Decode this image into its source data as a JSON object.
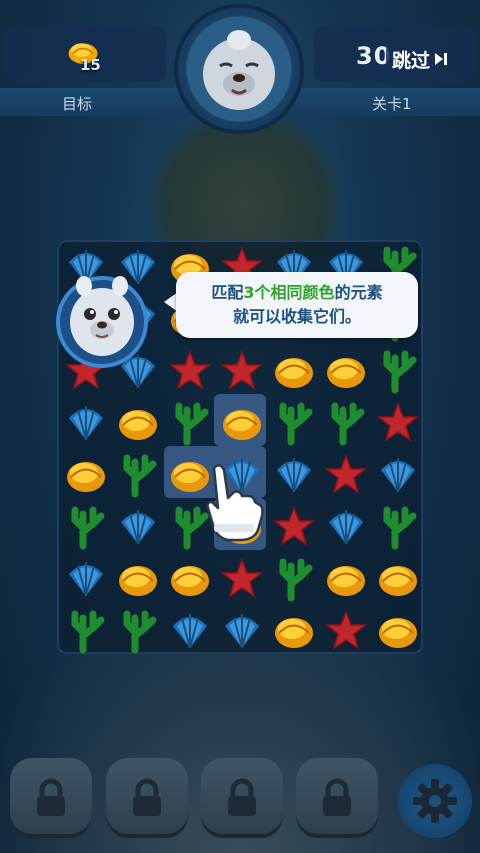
{
  "hud": {
    "goal_count": "15",
    "goal_label": "目标",
    "level_label": "关卡1",
    "moves_left": "30",
    "skip_label": "跳过"
  },
  "tutorial": {
    "line1_a": "匹配",
    "line1_b": "3个相同颜色",
    "line1_c": "的元素",
    "line2": "就可以收集它们。"
  },
  "board": {
    "grid": [
      [
        "blue-shell",
        "blue-shell",
        "yellow-snail",
        "red-star",
        "blue-shell",
        "blue-shell",
        "green-coral"
      ],
      [
        "blue-shell",
        "blue-shell",
        "yellow-snail",
        "red-star",
        "yellow-snail",
        "yellow-snail",
        "green-coral"
      ],
      [
        "red-star",
        "blue-shell",
        "red-star",
        "red-star",
        "yellow-snail",
        "yellow-snail",
        "green-coral"
      ],
      [
        "blue-shell",
        "yellow-snail",
        "green-coral",
        "yellow-snail",
        "green-coral",
        "green-coral",
        "red-star"
      ],
      [
        "yellow-snail",
        "green-coral",
        "yellow-snail",
        "blue-shell",
        "blue-shell",
        "red-star",
        "blue-shell"
      ],
      [
        "green-coral",
        "blue-shell",
        "green-coral",
        "yellow-snail",
        "red-star",
        "blue-shell",
        "green-coral"
      ],
      [
        "blue-shell",
        "yellow-snail",
        "yellow-snail",
        "red-star",
        "green-coral",
        "yellow-snail",
        "yellow-snail"
      ],
      [
        "green-coral",
        "green-coral",
        "blue-shell",
        "blue-shell",
        "yellow-snail",
        "red-star",
        "yellow-snail"
      ]
    ]
  },
  "buttons": {
    "locked": [
      "lock-icon",
      "lock-icon",
      "lock-icon",
      "lock-icon"
    ],
    "settings": "gear-icon"
  },
  "colors": {
    "accent_green": "#2ea32a",
    "bubble_text": "#1c4f82",
    "board_bg": "#0a1c2e"
  }
}
